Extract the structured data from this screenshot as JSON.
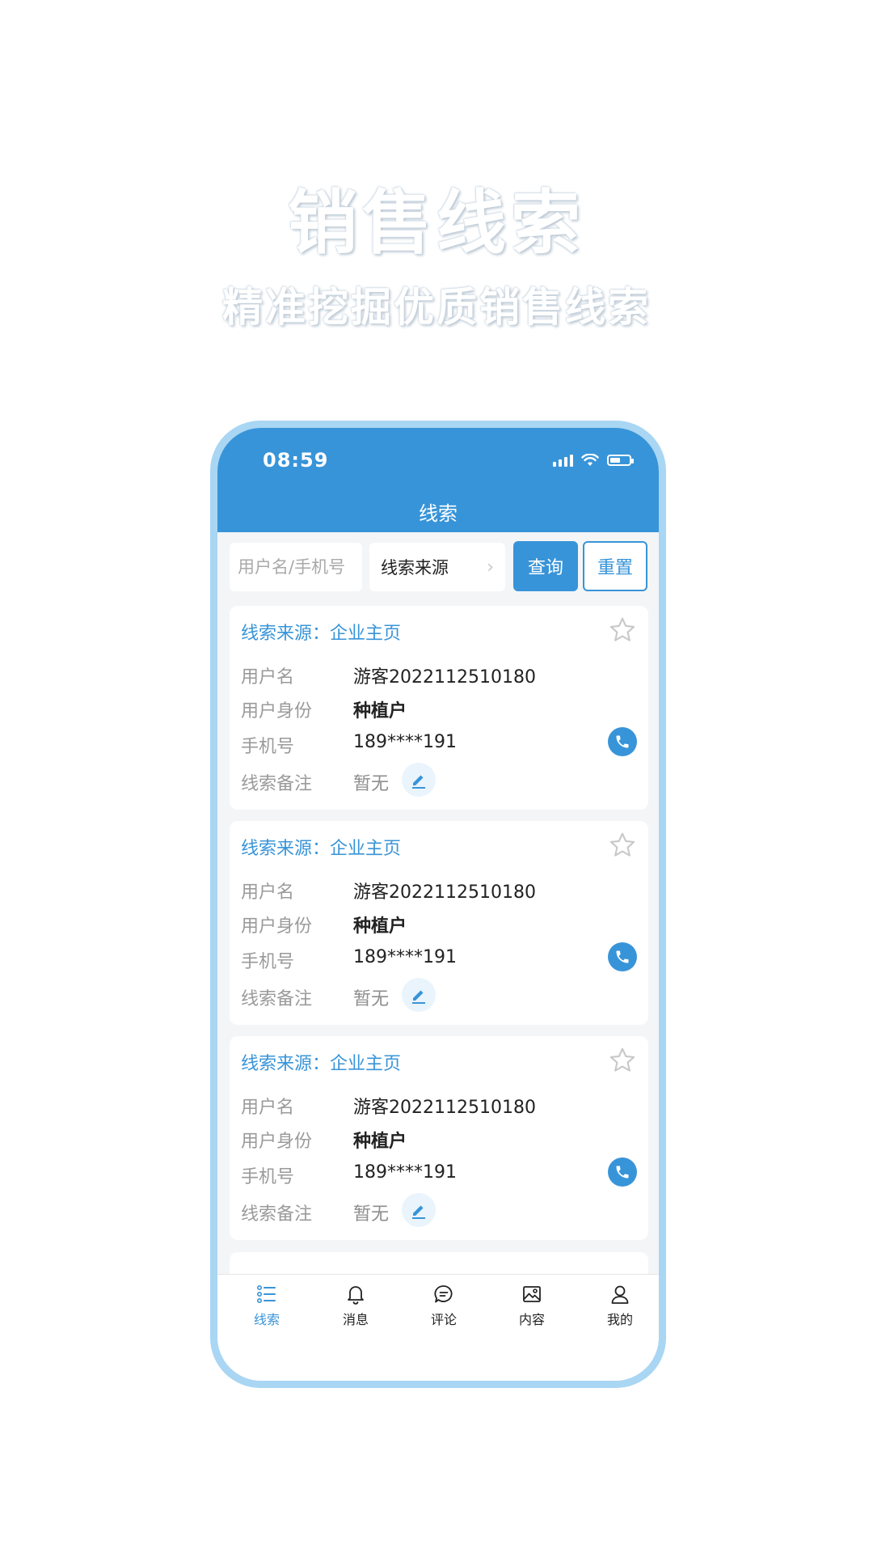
{
  "promo": {
    "title": "销售线索",
    "subtitle": "精准挖掘优质销售线索"
  },
  "status_bar": {
    "time": "08:59",
    "icons": [
      "signal-icon",
      "wifi-icon",
      "battery-icon"
    ]
  },
  "header": {
    "title": "线索"
  },
  "search": {
    "placeholder": "用户名/手机号",
    "source_label": "线索来源",
    "query_label": "查询",
    "reset_label": "重置"
  },
  "cards": [
    {
      "source": "线索来源：企业主页",
      "username_label": "用户名",
      "username": "游客2022112510180",
      "identity_label": "用户身份",
      "identity": "种植户",
      "phone_label": "手机号",
      "phone": "189****191",
      "note_label": "线索备注",
      "note": "暂无"
    },
    {
      "source": "线索来源：企业主页",
      "username_label": "用户名",
      "username": "游客2022112510180",
      "identity_label": "用户身份",
      "identity": "种植户",
      "phone_label": "手机号",
      "phone": "189****191",
      "note_label": "线索备注",
      "note": "暂无"
    },
    {
      "source": "线索来源：企业主页",
      "username_label": "用户名",
      "username": "游客2022112510180",
      "identity_label": "用户身份",
      "identity": "种植户",
      "phone_label": "手机号",
      "phone": "189****191",
      "note_label": "线索备注",
      "note": "暂无"
    }
  ],
  "tabbar": {
    "items": [
      {
        "label": "线索",
        "icon": "list-icon",
        "active": true
      },
      {
        "label": "消息",
        "icon": "bell-icon",
        "active": false
      },
      {
        "label": "评论",
        "icon": "comment-icon",
        "active": false
      },
      {
        "label": "内容",
        "icon": "image-icon",
        "active": false
      },
      {
        "label": "我的",
        "icon": "user-icon",
        "active": false
      }
    ]
  },
  "colors": {
    "primary": "#3894d8",
    "phone_frame": "#a9d6f3",
    "background": "#f4f5f7"
  }
}
